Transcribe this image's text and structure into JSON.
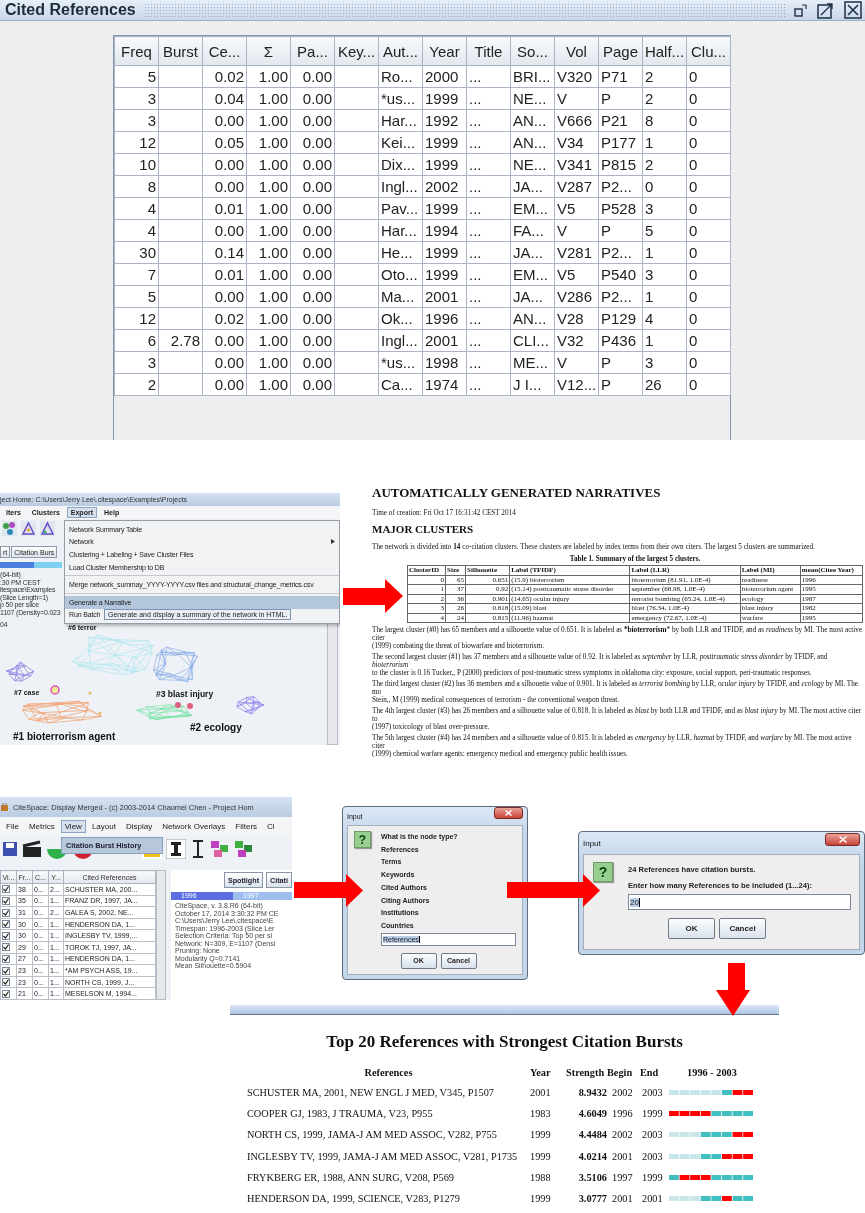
{
  "cited_references_window": {
    "title": "Cited References",
    "columns": [
      "Freq",
      "Burst",
      "Ce...",
      "Σ",
      "Pa...",
      "Key...",
      "Aut...",
      "Year",
      "Title",
      "So...",
      "Vol",
      "Page",
      "Half...",
      "Clu..."
    ],
    "rows": [
      [
        "5",
        null,
        "0.02",
        "1.00",
        "0.00",
        null,
        "Ro...",
        "2000",
        "...",
        "BRI...",
        "V320",
        "P71",
        "2",
        "0"
      ],
      [
        "3",
        null,
        "0.04",
        "1.00",
        "0.00",
        null,
        "*us...",
        "1999",
        "...",
        "NE...",
        "V",
        "P",
        "2",
        "0"
      ],
      [
        "3",
        null,
        "0.00",
        "1.00",
        "0.00",
        null,
        "Har...",
        "1992",
        "...",
        "AN...",
        "V666",
        "P21",
        "8",
        "0"
      ],
      [
        "12",
        null,
        "0.05",
        "1.00",
        "0.00",
        null,
        "Kei...",
        "1999",
        "...",
        "AN...",
        "V34",
        "P177",
        "1",
        "0"
      ],
      [
        "10",
        null,
        "0.00",
        "1.00",
        "0.00",
        null,
        "Dix...",
        "1999",
        "...",
        "NE...",
        "V341",
        "P815",
        "2",
        "0"
      ],
      [
        "8",
        null,
        "0.00",
        "1.00",
        "0.00",
        null,
        "Ingl...",
        "2002",
        "...",
        "JA...",
        "V287",
        "P2...",
        "0",
        "0"
      ],
      [
        "4",
        null,
        "0.01",
        "1.00",
        "0.00",
        null,
        "Pav...",
        "1999",
        "...",
        "EM...",
        "V5",
        "P528",
        "3",
        "0"
      ],
      [
        "4",
        null,
        "0.00",
        "1.00",
        "0.00",
        null,
        "Har...",
        "1994",
        "...",
        "FA...",
        "V",
        "P",
        "5",
        "0"
      ],
      [
        "30",
        null,
        "0.14",
        "1.00",
        "0.00",
        null,
        "He...",
        "1999",
        "...",
        "JA...",
        "V281",
        "P2...",
        "1",
        "0"
      ],
      [
        "7",
        null,
        "0.01",
        "1.00",
        "0.00",
        null,
        "Oto...",
        "1999",
        "...",
        "EM...",
        "V5",
        "P540",
        "3",
        "0"
      ],
      [
        "5",
        null,
        "0.00",
        "1.00",
        "0.00",
        null,
        "Ma...",
        "2001",
        "...",
        "JA...",
        "V286",
        "P2...",
        "1",
        "0"
      ],
      [
        "12",
        null,
        "0.02",
        "1.00",
        "0.00",
        null,
        "Ok...",
        "1996",
        "...",
        "AN...",
        "V28",
        "P129",
        "4",
        "0"
      ],
      [
        "6",
        "2.78",
        "0.00",
        "1.00",
        "0.00",
        null,
        "Ingl...",
        "2001",
        "...",
        "CLI...",
        "V32",
        "P436",
        "1",
        "0"
      ],
      [
        "3",
        null,
        "0.00",
        "1.00",
        "0.00",
        null,
        "*us...",
        "1998",
        "...",
        "ME...",
        "V",
        "P",
        "3",
        "0"
      ],
      [
        "2",
        null,
        "0.00",
        "1.00",
        "0.00",
        null,
        "Ca...",
        "1974",
        "...",
        "J I...",
        "V12...",
        "P",
        "26",
        "0"
      ]
    ]
  },
  "export_menu_screenshot": {
    "title": "ject Home: C:\\Users\\Jerry Lee\\.citespace\\Examples\\Projects",
    "menus": [
      {
        "label": "lters",
        "selected": false
      },
      {
        "label": "Clusters",
        "selected": false
      },
      {
        "label": "Export",
        "selected": true
      },
      {
        "label": "Help",
        "selected": false
      }
    ],
    "buttons": [
      "rt",
      "Citation Burs"
    ],
    "info_lines": [
      "(64-bit)",
      ":30 PM CEST",
      "itespace\\Examples",
      "(Slice Length=1)",
      "p 50 per slice",
      "1107 (Density=0.023",
      "04"
    ],
    "menu_items": [
      {
        "kind": "item",
        "label": "Network Summary Table",
        "selected": false
      },
      {
        "kind": "submenu",
        "label": "Network",
        "selected": false
      },
      {
        "kind": "item",
        "label": "Clustering + Labeling + Save Cluster Files",
        "selected": false
      },
      {
        "kind": "item",
        "label": "Load Cluster Membership to DB",
        "selected": false
      },
      {
        "kind": "separator"
      },
      {
        "kind": "item",
        "label": "Merge network_summay_YYYY-YYYY.csv files and structural_change_metrics.csv",
        "selected": false
      },
      {
        "kind": "separator"
      },
      {
        "kind": "item",
        "label": "Generate a Narrative",
        "selected": true
      },
      {
        "kind": "item",
        "label": "Run Batch",
        "selected": false
      }
    ],
    "tooltip": "Generate and display a summary of the network in HTML.",
    "cluster_labels": [
      "#6 terror",
      "#7 case",
      "#3 blast injury",
      "#2 ecology",
      "#1 bioterrorism agent"
    ]
  },
  "narrative": {
    "title": "AUTOMATICALLY GENERATED NARRATIVES",
    "time": "Time of creation: Fri Oct 17 16:31:42 CEST 2014",
    "section_title": "MAJOR CLUSTERS",
    "intro": "The network is divided into **14** co-citation clusters. These clusters are labeled by index terms from their own citers. The largest 5 clusters are summarized.",
    "table_caption": "Table 1. Summary of the largest 5 clusters.",
    "table": {
      "columns": [
        "ClusterID",
        "Size",
        "Silhouette",
        "Label (TFIDF)",
        "Label (LLR)",
        "Label (MI)",
        "mean(Citee Year)"
      ],
      "rows": [
        [
          "0",
          "65",
          "0.651",
          "(15.9) bioterrorism",
          "bioterrorism (81.91, 1.0E-4)",
          "readiness",
          "1996"
        ],
        [
          "1",
          "37",
          "0.92",
          "(15.14) posttraumatic stress disorder",
          "september (68.98, 1.0E-4)",
          "bioterrorism agent",
          "1995"
        ],
        [
          "2",
          "36",
          "0.901",
          "(14.65) ocular injury",
          "terrorist bombing (65.24, 1.0E-4)",
          "ecology",
          "1987"
        ],
        [
          "3",
          "26",
          "0.818",
          "(15.09) blast",
          "blast (76.34, 1.0E-4)",
          "blast injury",
          "1982"
        ],
        [
          "4",
          "24",
          "0.815",
          "(11.96) hazmat",
          "emergency (72.67, 1.0E-4)",
          "warfare",
          "1995"
        ]
      ]
    },
    "paragraphs": [
      [
        "The largest cluster (#0) has 65 members and a silhouette value of 0.651. It is labeled as ***bioterrorism*** by both LLR and TFIDF, and as *readiness* by MI. The most active citer",
        "(1999) combating the threat of biowarfare and bioterrorism."
      ],
      [
        "The second largest cluster (#1) has 37 members and a silhouette value of 0.92. It is labeled as *september* by LLR, *posttraumatic stress disorder* by TFIDF, and *bioterrorism*",
        "to the cluster is 0.16 Tucker,, P (2000) predictors of post-traumatic stress symptoms in oklahoma city: exposure, social support, peri-traumatic responses."
      ],
      [
        "The third largest cluster (#2) has 36 members and a silhouette value of 0.901. It is labeled as *terrorist bombing* by LLR, *ocular injury* by TFIDF, and *ecology* by MI. The mo",
        "Stein,, M (1999) medical consequences of terrorism - the conventional weapon threat."
      ],
      [
        "The 4th largest cluster (#3) has 26 members and a silhouette value of 0.818. It is labeled as *blast* by both LLR and TFIDF, and as *blast injury* by MI. The most active citer to",
        "(1997) toxicology of blast over-pressure."
      ],
      [
        "The 5th largest cluster (#4) has 24 members and a silhouette value of 0.815. It is labeled as *emergency* by LLR, *hazmat* by TFIDF, and *warfare* by MI. The most active citer",
        "(1999) chemical warfare agents: emergency medical and emergency public health issues."
      ]
    ]
  },
  "citespace_window": {
    "title": "CiteSpace: Display Merged - (c) 2003-2014 Chaomei Chen - Project Hom",
    "menus": [
      {
        "label": "File",
        "selected": false
      },
      {
        "label": "Metrics",
        "selected": false
      },
      {
        "label": "View",
        "selected": true
      },
      {
        "label": "Layout",
        "selected": false
      },
      {
        "label": "Display",
        "selected": false
      },
      {
        "label": "Network Overlays",
        "selected": false
      },
      {
        "label": "Filters",
        "selected": false
      },
      {
        "label": "Cl",
        "selected": false
      }
    ],
    "dropdown_item": "Citation Burst History",
    "checkbox_column": "Vi...",
    "columns": [
      "Fr...",
      "C...",
      "Y...",
      "Cited References"
    ],
    "rows": [
      {
        "visible": true,
        "cells": [
          "38",
          "0...",
          "2...",
          "SCHUSTER MA, 200..."
        ]
      },
      {
        "visible": true,
        "cells": [
          "35",
          "0...",
          "1...",
          "FRANZ DR, 1997, JA..."
        ]
      },
      {
        "visible": true,
        "cells": [
          "31",
          "0...",
          "2...",
          "GALEA S, 2002, NE..."
        ]
      },
      {
        "visible": true,
        "cells": [
          "30",
          "0...",
          "1...",
          "HENDERSON DA, 1..."
        ]
      },
      {
        "visible": true,
        "cells": [
          "30",
          "0...",
          "1...",
          "INGLESBY TV, 1999,..."
        ]
      },
      {
        "visible": true,
        "cells": [
          "29",
          "0...",
          "1...",
          "TOROK TJ, 1997, JA..."
        ]
      },
      {
        "visible": true,
        "cells": [
          "27",
          "0...",
          "1...",
          "HENDERSON DA, 1..."
        ]
      },
      {
        "visible": true,
        "cells": [
          "23",
          "0...",
          "1...",
          "*AM PSYCH ASS, 19..."
        ]
      },
      {
        "visible": true,
        "cells": [
          "23",
          "0...",
          "1...",
          "NORTH CS, 1999, J..."
        ]
      },
      {
        "visible": true,
        "cells": [
          "21",
          "0...",
          "1...",
          "MESELSON M, 1994..."
        ]
      }
    ],
    "buttons": [
      "Spotlight",
      "Citati"
    ],
    "timeline": [
      "1996",
      "1997"
    ],
    "info_lines": [
      "CiteSpace, v. 3.8.R6 (64-bit)",
      "October 17, 2014 3:30:32 PM CE",
      "C:\\Users\\Jerry Lee\\.citespace\\E",
      "Timespan: 1996-2003 (Slice Ler",
      "Selection Criteria: Top 50 per sl",
      "Network: N=309, E=1107 (Densi",
      "Pruning: None",
      "Modularity Q=0.7141",
      "Mean Silhouette=0.5904"
    ]
  },
  "node_type_dialog": {
    "title": "Input",
    "icon": "?",
    "lines": [
      "What is the node type?",
      "References",
      "Terms",
      "Keywords",
      "Cited Authors",
      "Citing Authors",
      "Institutions",
      "Countries"
    ],
    "value": "References",
    "buttons": [
      "OK",
      "Cancel"
    ]
  },
  "burst_count_dialog": {
    "title": "Input",
    "icon": "?",
    "message": "24 References have citation bursts.",
    "prompt": "Enter how many References to be included (1...24):",
    "value": "20",
    "buttons": [
      "OK",
      "Cancel"
    ]
  },
  "burst_report": {
    "title": "Top 20 References with Strongest Citation Bursts",
    "columns": [
      "References",
      "Year",
      "Strength",
      "Begin",
      "End",
      "1996 - 2003"
    ],
    "rows": [
      {
        "reference": "SCHUSTER MA, 2001, NEW ENGL J MED, V345, P1507",
        "year": "2001",
        "strength": "8.9432",
        "begin": "2002",
        "end": "2003",
        "segments": [
          {
            "kind": "outside"
          },
          {
            "kind": "outside"
          },
          {
            "kind": "outside"
          },
          {
            "kind": "outside"
          },
          {
            "kind": "outside"
          },
          {
            "kind": "active"
          },
          {
            "kind": "burst"
          },
          {
            "kind": "burst"
          }
        ]
      },
      {
        "reference": "COOPER GJ, 1983, J TRAUMA, V23, P955",
        "year": "1983",
        "strength": "4.6049",
        "begin": "1996",
        "end": "1999",
        "segments": [
          {
            "kind": "burst"
          },
          {
            "kind": "burst"
          },
          {
            "kind": "burst"
          },
          {
            "kind": "burst"
          },
          {
            "kind": "active"
          },
          {
            "kind": "active"
          },
          {
            "kind": "active"
          },
          {
            "kind": "active"
          }
        ]
      },
      {
        "reference": "NORTH CS, 1999, JAMA-J AM MED ASSOC, V282, P755",
        "year": "1999",
        "strength": "4.4484",
        "begin": "2002",
        "end": "2003",
        "segments": [
          {
            "kind": "outside"
          },
          {
            "kind": "outside"
          },
          {
            "kind": "outside"
          },
          {
            "kind": "active"
          },
          {
            "kind": "active"
          },
          {
            "kind": "active"
          },
          {
            "kind": "burst"
          },
          {
            "kind": "burst"
          }
        ]
      },
      {
        "reference": "INGLESBY TV, 1999, JAMA-J AM MED ASSOC, V281, P1735",
        "year": "1999",
        "strength": "4.0214",
        "begin": "2001",
        "end": "2003",
        "segments": [
          {
            "kind": "outside"
          },
          {
            "kind": "outside"
          },
          {
            "kind": "outside"
          },
          {
            "kind": "active"
          },
          {
            "kind": "active"
          },
          {
            "kind": "burst"
          },
          {
            "kind": "burst"
          },
          {
            "kind": "burst"
          }
        ]
      },
      {
        "reference": "FRYKBERG ER, 1988, ANN SURG, V208, P569",
        "year": "1988",
        "strength": "3.5106",
        "begin": "1997",
        "end": "1999",
        "segments": [
          {
            "kind": "active"
          },
          {
            "kind": "burst"
          },
          {
            "kind": "burst"
          },
          {
            "kind": "burst"
          },
          {
            "kind": "active"
          },
          {
            "kind": "active"
          },
          {
            "kind": "active"
          },
          {
            "kind": "active"
          }
        ]
      },
      {
        "reference": "HENDERSON DA, 1999, SCIENCE, V283, P1279",
        "year": "1999",
        "strength": "3.0777",
        "begin": "2001",
        "end": "2001",
        "segments": [
          {
            "kind": "outside"
          },
          {
            "kind": "outside"
          },
          {
            "kind": "outside"
          },
          {
            "kind": "active"
          },
          {
            "kind": "active"
          },
          {
            "kind": "burst"
          },
          {
            "kind": "active"
          },
          {
            "kind": "active"
          }
        ]
      }
    ]
  }
}
